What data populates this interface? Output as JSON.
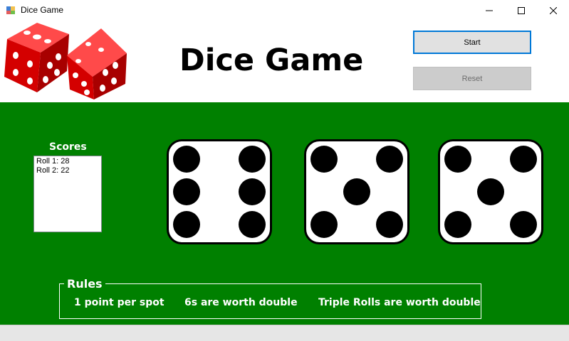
{
  "window": {
    "title": "Dice Game"
  },
  "header": {
    "title": "Dice Game"
  },
  "buttons": {
    "start": "Start",
    "reset": "Reset"
  },
  "scores": {
    "label": "Scores",
    "items": [
      "Roll 1: 28",
      "Roll 2: 22"
    ]
  },
  "dice": [
    6,
    5,
    5
  ],
  "rules": {
    "title": "Rules",
    "items": [
      "1 point per spot",
      "6s are worth double",
      "Triple Rolls are worth double"
    ]
  },
  "colors": {
    "felt": "#008000",
    "logo_red": "#d40000",
    "start_border": "#0078d7"
  }
}
